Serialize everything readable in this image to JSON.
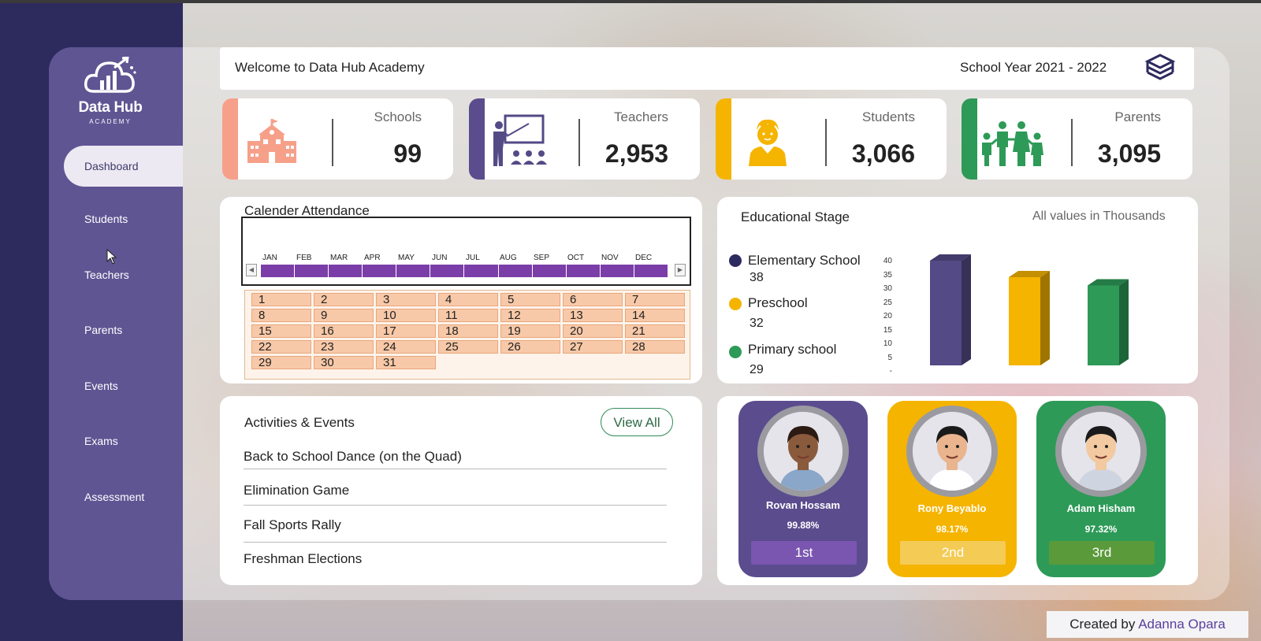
{
  "colors": {
    "sidebar": "#5f5593",
    "schools_accent": "#f6a08a",
    "teachers_accent": "#5b4c8e",
    "students_accent": "#f5b400",
    "parents_accent": "#2e9a57",
    "attendance_track": "#7b3ea8"
  },
  "logo": {
    "title": "Data Hub",
    "subtitle": "ACADEMY"
  },
  "nav": {
    "items": [
      {
        "label": "Dashboard",
        "active": true
      },
      {
        "label": "Students"
      },
      {
        "label": "Teachers"
      },
      {
        "label": "Parents"
      },
      {
        "label": "Events"
      },
      {
        "label": "Exams"
      },
      {
        "label": "Assessment"
      }
    ]
  },
  "header": {
    "welcome": "Welcome to Data Hub Academy",
    "school_year": "School Year 2021 - 2022",
    "icon": "books-icon"
  },
  "kpis": [
    {
      "label": "Schools",
      "value": "99",
      "icon": "school-building-icon"
    },
    {
      "label": "Teachers",
      "value": "2,953",
      "icon": "teacher-classroom-icon"
    },
    {
      "label": "Students",
      "value": "3,066",
      "icon": "student-icon"
    },
    {
      "label": "Parents",
      "value": "3,095",
      "icon": "family-icon"
    }
  ],
  "calendar": {
    "title": "Calender Attendance",
    "months": [
      "JAN",
      "FEB",
      "MAR",
      "APR",
      "MAY",
      "JUN",
      "JUL",
      "AUG",
      "SEP",
      "OCT",
      "NOV",
      "DEC"
    ],
    "days": [
      "1",
      "2",
      "3",
      "4",
      "5",
      "6",
      "7",
      "8",
      "9",
      "10",
      "11",
      "12",
      "13",
      "14",
      "15",
      "16",
      "17",
      "18",
      "19",
      "20",
      "21",
      "22",
      "23",
      "24",
      "25",
      "26",
      "27",
      "28",
      "29",
      "30",
      "31"
    ]
  },
  "educational_stage": {
    "title": "Educational Stage",
    "note": "All values in Thousands",
    "legend": [
      {
        "label": "Elementary School",
        "value": "38"
      },
      {
        "label": "Preschool",
        "value": "32"
      },
      {
        "label": "Primary school",
        "value": "29"
      }
    ],
    "y_ticks": [
      "40",
      "35",
      "30",
      "25",
      "20",
      "15",
      "10",
      "5",
      "-"
    ]
  },
  "chart_data": {
    "type": "bar",
    "categories": [
      "Elementary School",
      "Preschool",
      "Primary school"
    ],
    "values": [
      38,
      32,
      29
    ],
    "colors": [
      "#544a86",
      "#f5b400",
      "#2e9a57"
    ],
    "ylim": [
      0,
      40
    ],
    "title": "Educational Stage"
  },
  "activities": {
    "title": "Activities & Events",
    "view_all_label": "View All",
    "items": [
      "Back to School Dance (on the Quad)",
      "Elimination Game",
      "Fall Sports Rally",
      "Freshman Elections"
    ]
  },
  "top_students": [
    {
      "name": "Rovan Hossam",
      "percent": "99.88%",
      "rank": "1st",
      "bg": "#5b4c8e",
      "rank_bg": "#7a56b0"
    },
    {
      "name": "Rony Beyablo",
      "percent": "98.17%",
      "rank": "2nd",
      "bg": "#f5b400",
      "rank_bg": "#f3cb55"
    },
    {
      "name": "Adam Hisham",
      "percent": "97.32%",
      "rank": "3rd",
      "bg": "#2e9a57",
      "rank_bg": "#5a9a3a"
    }
  ],
  "footer": {
    "credit_prefix": "Created by",
    "credit_name": "Adanna Opara"
  }
}
